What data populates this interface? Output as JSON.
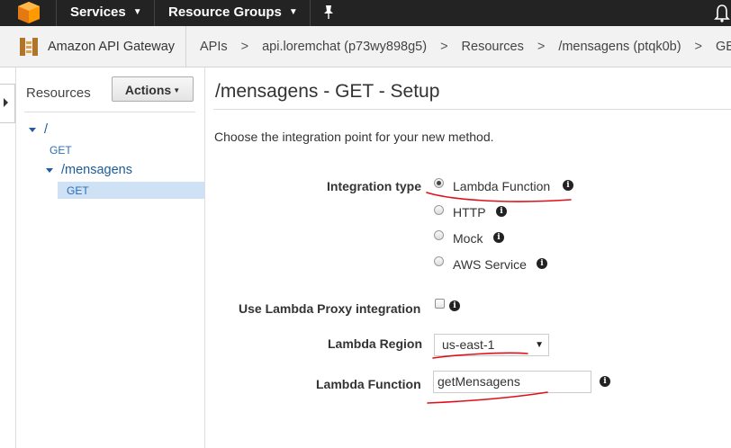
{
  "topbar": {
    "services_label": "Services",
    "resource_groups_label": "Resource Groups"
  },
  "breadcrumb": {
    "service_name": "Amazon API Gateway",
    "items": [
      "APIs",
      "api.loremchat (p73wy898g5)",
      "Resources",
      "/mensagens (ptqk0b)",
      "GET"
    ]
  },
  "resources_panel": {
    "title": "Resources",
    "actions_label": "Actions",
    "tree": {
      "root_path": "/",
      "root_method": "GET",
      "child_path": "/mensagens",
      "child_method": "GET"
    }
  },
  "main": {
    "title": "/mensagens - GET - Setup",
    "intro": "Choose the integration point for your new method.",
    "integration_type_label": "Integration type",
    "integration_options": [
      "Lambda Function",
      "HTTP",
      "Mock",
      "AWS Service"
    ],
    "selected_integration": "Lambda Function",
    "proxy_label": "Use Lambda Proxy integration",
    "proxy_checked": false,
    "region_label": "Lambda Region",
    "region_value": "us-east-1",
    "function_label": "Lambda Function",
    "function_value": "getMensagens"
  },
  "colors": {
    "topbar_bg": "#232323",
    "link_blue": "#1b5c99",
    "selected_row_bg": "#cfe2f5",
    "annotation_red": "#e0101a"
  }
}
